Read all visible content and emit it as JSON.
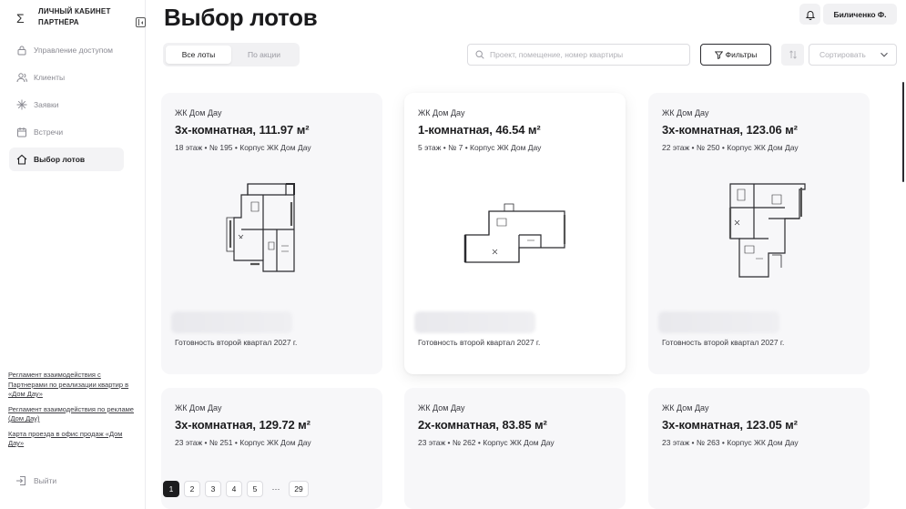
{
  "sidebar": {
    "brand_logo": "Σ",
    "brand_title": "ЛИЧНЫЙ КАБИНЕТ ПАРТНЁРА",
    "items": [
      {
        "label": "Управление доступом",
        "icon": "lock-icon",
        "active": false
      },
      {
        "label": "Клиенты",
        "icon": "users-icon",
        "active": false
      },
      {
        "label": "Заявки",
        "icon": "sparkle-icon",
        "active": false
      },
      {
        "label": "Встречи",
        "icon": "calendar-icon",
        "active": false
      },
      {
        "label": "Выбор лотов",
        "icon": "home-icon",
        "active": true
      }
    ],
    "links": [
      "Регламент взаимодействия с Партнерами по реализации квартир в «Дом Дау»",
      "Регламент взаимодействия по рекламе (Дом Дау)",
      "Карта проезда в офис продаж «Дом Дау»"
    ],
    "logout_label": "Выйти"
  },
  "header": {
    "title": "Выбор лотов",
    "user_name": "Биличенко Ф."
  },
  "controls": {
    "tabs": [
      {
        "label": "Все лоты",
        "active": true
      },
      {
        "label": "По акции",
        "active": false
      }
    ],
    "search_placeholder": "Проект, помещение, номер квартиры",
    "filter_label": "Фильтры",
    "sort_placeholder": "Сортировать"
  },
  "cards": [
    {
      "project": "ЖК Дом Дау",
      "title": "3х-комнатная, 111.97 м²",
      "meta": "18 этаж • № 195 • Корпус ЖК Дом Дау",
      "ready": "Готовность второй квартал 2027 г.",
      "plan": "plan-a",
      "highlight": false
    },
    {
      "project": "ЖК Дом Дау",
      "title": "1-комнатная, 46.54 м²",
      "meta": "5 этаж • № 7 • Корпус ЖК Дом Дау",
      "ready": "Готовность второй квартал 2027 г.",
      "plan": "plan-b",
      "highlight": true
    },
    {
      "project": "ЖК Дом Дау",
      "title": "3х-комнатная, 123.06 м²",
      "meta": "22 этаж • № 250 • Корпус ЖК Дом Дау",
      "ready": "Готовность второй квартал 2027 г.",
      "plan": "plan-c",
      "highlight": false
    },
    {
      "project": "ЖК Дом Дау",
      "title": "3х-комнатная, 129.72 м²",
      "meta": "23 этаж • № 251 • Корпус ЖК Дом Дау",
      "ready": "",
      "plan": "",
      "highlight": false
    },
    {
      "project": "ЖК Дом Дау",
      "title": "2х-комнатная, 83.85 м²",
      "meta": "23 этаж • № 262 • Корпус ЖК Дом Дау",
      "ready": "",
      "plan": "",
      "highlight": false
    },
    {
      "project": "ЖК Дом Дау",
      "title": "3х-комнатная, 123.05 м²",
      "meta": "23 этаж • № 263 • Корпус ЖК Дом Дау",
      "ready": "",
      "plan": "",
      "highlight": false
    }
  ],
  "pagination": {
    "pages": [
      "1",
      "2",
      "3",
      "4",
      "5"
    ],
    "current": "1",
    "ellipsis": "···",
    "last": "29"
  },
  "colors": {
    "accent": "#1d1d1f",
    "card_bg": "#f7f7f9",
    "muted_text": "#8a8a92"
  }
}
